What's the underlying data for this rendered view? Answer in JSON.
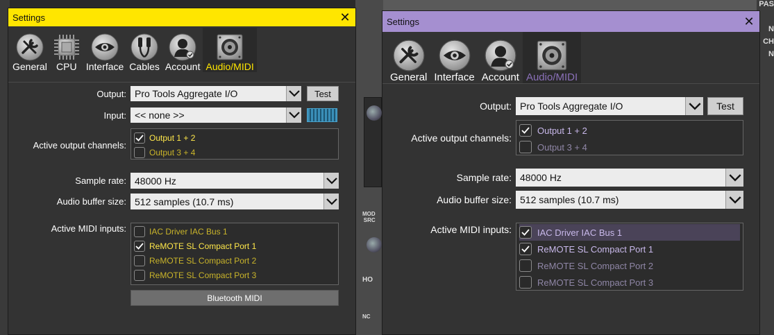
{
  "colors": {
    "left_accent": "#ffe600",
    "right_accent": "#8a70b8",
    "right_titlebar": "#a58fd0",
    "left_active_item": "#ffe84a",
    "left_dim_item": "#c9b42a",
    "right_active_item": "#c8b8ea",
    "right_dim_item": "#8f86a6"
  },
  "left": {
    "title": "Settings",
    "close_glyph": "✕",
    "tabs": [
      {
        "label": "General",
        "icon": "wrench-screwdriver-icon"
      },
      {
        "label": "CPU",
        "icon": "cpu-chip-icon"
      },
      {
        "label": "Interface",
        "icon": "eye-icon"
      },
      {
        "label": "Cables",
        "icon": "audio-cable-icon"
      },
      {
        "label": "Account",
        "icon": "user-account-icon"
      },
      {
        "label": "Audio/MIDI",
        "icon": "speaker-icon"
      }
    ],
    "output_label": "Output:",
    "output_value": "Pro Tools Aggregate I/O",
    "test_label": "Test",
    "input_label": "Input:",
    "input_value": "<< none >>",
    "active_outputs_label": "Active output channels:",
    "outputs": [
      {
        "label": "Output 1 + 2",
        "checked": true
      },
      {
        "label": "Output 3 + 4",
        "checked": false
      }
    ],
    "sample_rate_label": "Sample rate:",
    "sample_rate_value": "48000 Hz",
    "buffer_label": "Audio buffer size:",
    "buffer_value": "512 samples (10.7 ms)",
    "midi_label": "Active MIDI inputs:",
    "midi_inputs": [
      {
        "label": "IAC Driver IAC Bus 1",
        "checked": false
      },
      {
        "label": "ReMOTE SL Compact Port 1",
        "checked": true
      },
      {
        "label": "ReMOTE SL Compact Port 2",
        "checked": false
      },
      {
        "label": "ReMOTE SL Compact Port 3",
        "checked": false
      }
    ],
    "bluetooth_label": "Bluetooth MIDI"
  },
  "right": {
    "title": "Settings",
    "close_glyph": "✕",
    "tabs": [
      {
        "label": "General",
        "icon": "wrench-screwdriver-icon"
      },
      {
        "label": "Interface",
        "icon": "eye-icon"
      },
      {
        "label": "Account",
        "icon": "user-account-icon"
      },
      {
        "label": "Audio/MIDI",
        "icon": "speaker-icon"
      }
    ],
    "output_label": "Output:",
    "output_value": "Pro Tools Aggregate I/O",
    "test_label": "Test",
    "active_outputs_label": "Active output channels:",
    "outputs": [
      {
        "label": "Output 1 + 2",
        "checked": true
      },
      {
        "label": "Output 3 + 4",
        "checked": false
      }
    ],
    "sample_rate_label": "Sample rate:",
    "sample_rate_value": "48000 Hz",
    "buffer_label": "Audio buffer size:",
    "buffer_value": "512 samples (10.7 ms)",
    "midi_label": "Active MIDI inputs:",
    "midi_inputs": [
      {
        "label": "IAC Driver IAC Bus 1",
        "checked": true
      },
      {
        "label": "ReMOTE SL Compact Port 1",
        "checked": true
      },
      {
        "label": "ReMOTE SL Compact Port 2",
        "checked": false
      },
      {
        "label": "ReMOTE SL Compact Port 3",
        "checked": false
      }
    ]
  },
  "background": {
    "mid_labels": [
      "MOD\nSRC",
      "NC",
      "HO"
    ],
    "right_labels": [
      "PAS",
      "N",
      "CH",
      "N"
    ]
  }
}
